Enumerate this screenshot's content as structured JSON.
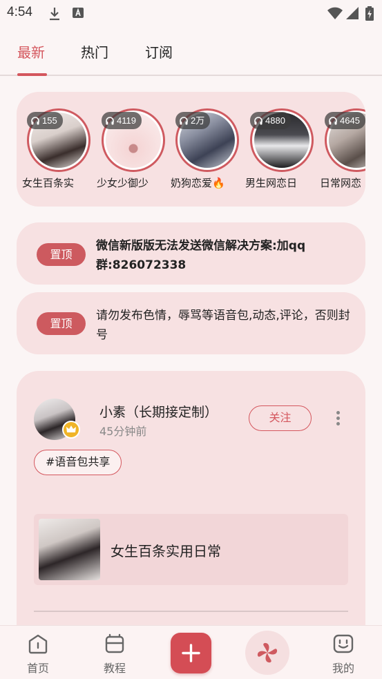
{
  "status_bar": {
    "time": "4:54"
  },
  "tabs": [
    {
      "label": "最新",
      "active": true
    },
    {
      "label": "热门",
      "active": false
    },
    {
      "label": "订阅",
      "active": false
    }
  ],
  "stories": [
    {
      "count": "155",
      "name": "女生百条实"
    },
    {
      "count": "4119",
      "name": "少女少御少"
    },
    {
      "count": "2万",
      "name": "奶狗恋爱🔥"
    },
    {
      "count": "4880",
      "name": "男生网恋日"
    },
    {
      "count": "4645",
      "name": "日常网恋"
    }
  ],
  "pinned": [
    {
      "badge": "置顶",
      "text": "微信新版版无法发送微信解决方案:加qq群:826072338"
    },
    {
      "badge": "置顶",
      "text": "请勿发布色情，辱骂等语音包,动态,评论，否则封号"
    }
  ],
  "post": {
    "username": "小素（长期接定制）",
    "time": "45分钟前",
    "follow_label": "关注",
    "tag": "#语音包共享",
    "voice_title": "女生百条实用日常"
  },
  "bottom_nav": {
    "home": "首页",
    "tutorial": "教程",
    "mine": "我的"
  },
  "colors": {
    "accent": "#d4565d",
    "card_bg": "#f7e1e2",
    "page_bg": "#fbf5f5"
  }
}
